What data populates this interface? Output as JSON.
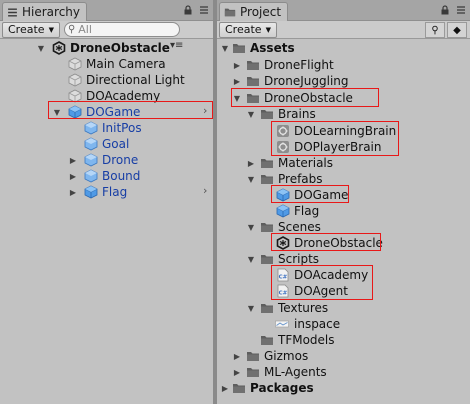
{
  "hierarchy": {
    "title": "Hierarchy",
    "create_label": "Create",
    "search_placeholder": "All",
    "scene": "DroneObstacle",
    "items": [
      {
        "label": "Main Camera"
      },
      {
        "label": "Directional Light"
      },
      {
        "label": "DOAcademy"
      },
      {
        "label": "DOGame"
      },
      {
        "label": "InitPos"
      },
      {
        "label": "Goal"
      },
      {
        "label": "Drone"
      },
      {
        "label": "Bound"
      },
      {
        "label": "Flag"
      }
    ]
  },
  "project": {
    "title": "Project",
    "create_label": "Create",
    "tree": [
      {
        "label": "Assets"
      },
      {
        "label": "DroneFlight"
      },
      {
        "label": "DroneJuggling"
      },
      {
        "label": "DroneObstacle"
      },
      {
        "label": "Brains"
      },
      {
        "label": "DOLearningBrain"
      },
      {
        "label": "DOPlayerBrain"
      },
      {
        "label": "Materials"
      },
      {
        "label": "Prefabs"
      },
      {
        "label": "DOGame"
      },
      {
        "label": "Flag"
      },
      {
        "label": "Scenes"
      },
      {
        "label": "DroneObstacle"
      },
      {
        "label": "Scripts"
      },
      {
        "label": "DOAcademy"
      },
      {
        "label": "DOAgent"
      },
      {
        "label": "Textures"
      },
      {
        "label": "inspace"
      },
      {
        "label": "TFModels"
      },
      {
        "label": "Gizmos"
      },
      {
        "label": "ML-Agents"
      },
      {
        "label": "Packages"
      }
    ]
  },
  "colors": {
    "highlight_border": "#e81818",
    "prefab_text": "#173ea5",
    "folder": "#5b5b5b"
  }
}
